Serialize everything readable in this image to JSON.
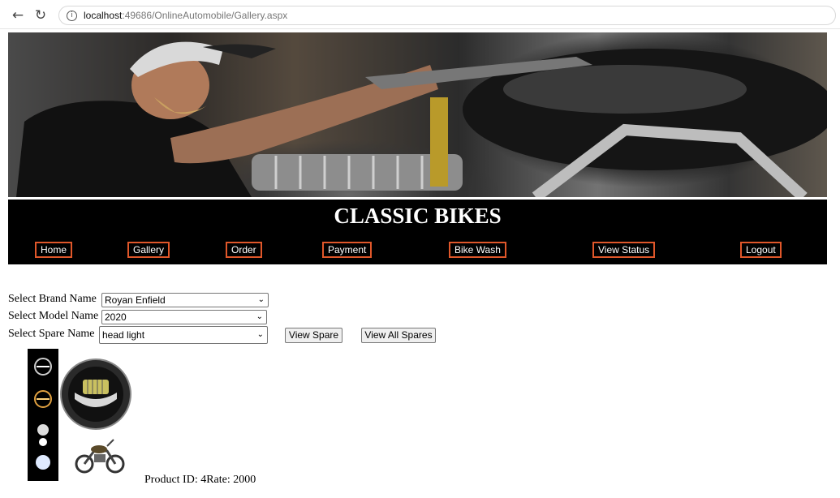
{
  "browser": {
    "url_host": "localhost",
    "url_rest": ":49686/OnlineAutomobile/Gallery.aspx"
  },
  "site": {
    "title": "CLASSIC BIKES"
  },
  "nav": {
    "home": "Home",
    "gallery": "Gallery",
    "order": "Order",
    "payment": "Payment",
    "bike_wash": "Bike Wash",
    "view_status": "View Status",
    "logout": "Logout"
  },
  "form": {
    "brand_label": "Select Brand Name",
    "brand_value": "Royan Enfield",
    "model_label": "Select Model Name",
    "model_value": "2020",
    "spare_label": "Select Spare Name",
    "spare_value": "head light",
    "view_spare_button": "View Spare",
    "view_all_spares_button": "View All Spares"
  },
  "product": {
    "info": "Product ID: 4Rate: 2000"
  },
  "colors": {
    "nav_border": "#e0572a",
    "header_bg": "#000000"
  }
}
